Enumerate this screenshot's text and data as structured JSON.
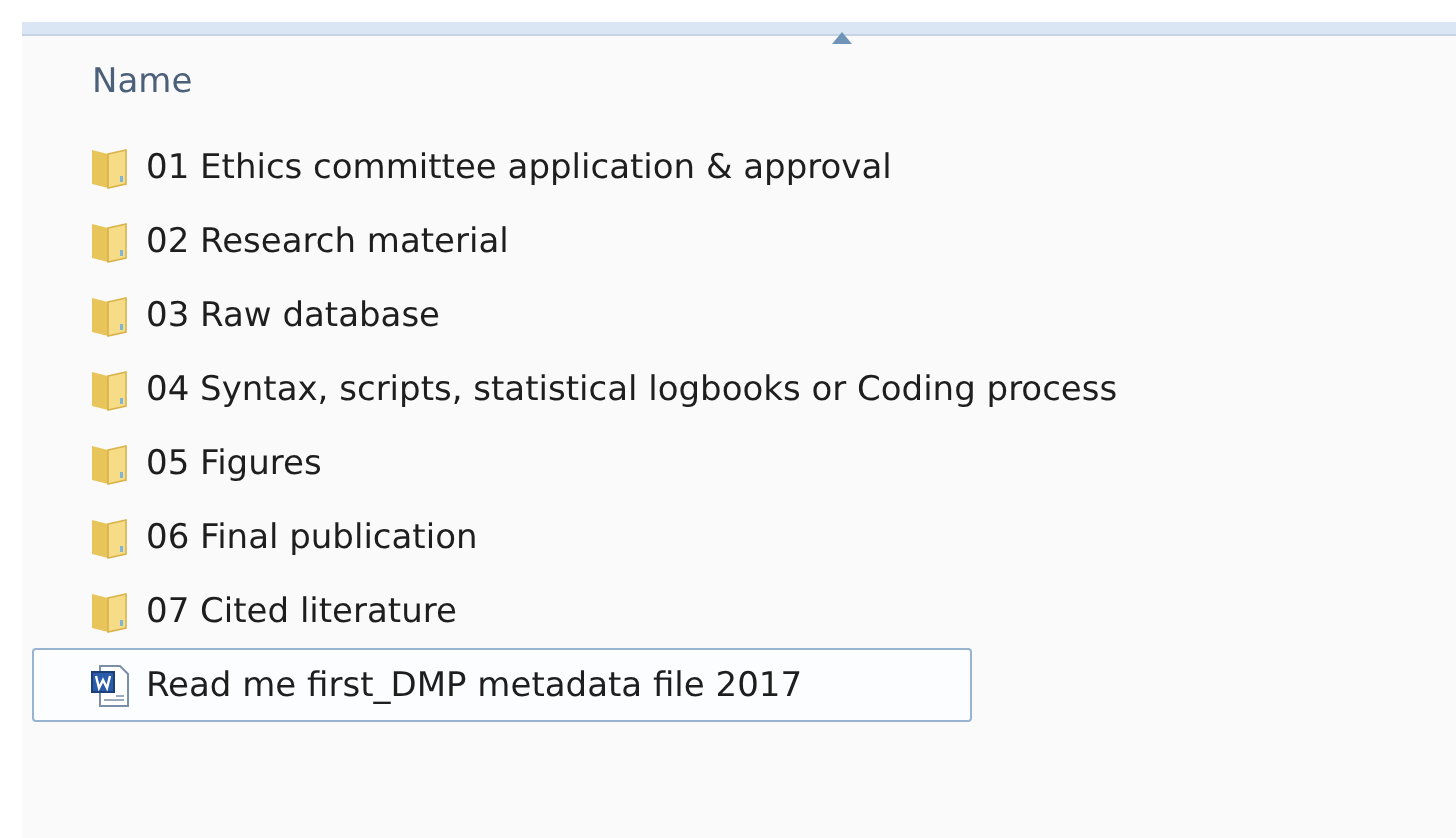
{
  "header": {
    "column_name": "Name"
  },
  "items": [
    {
      "kind": "folder",
      "label": "01 Ethics committee application & approval",
      "selected": false
    },
    {
      "kind": "folder",
      "label": "02 Research material",
      "selected": false
    },
    {
      "kind": "folder",
      "label": "03 Raw database",
      "selected": false
    },
    {
      "kind": "folder",
      "label": "04 Syntax, scripts, statistical logbooks or Coding process",
      "selected": false
    },
    {
      "kind": "folder",
      "label": "05 Figures",
      "selected": false
    },
    {
      "kind": "folder",
      "label": "06 Final publication",
      "selected": false
    },
    {
      "kind": "folder",
      "label": "07 Cited literature",
      "selected": false
    },
    {
      "kind": "document",
      "label": "Read me first_DMP metadata file 2017",
      "selected": true
    }
  ]
}
